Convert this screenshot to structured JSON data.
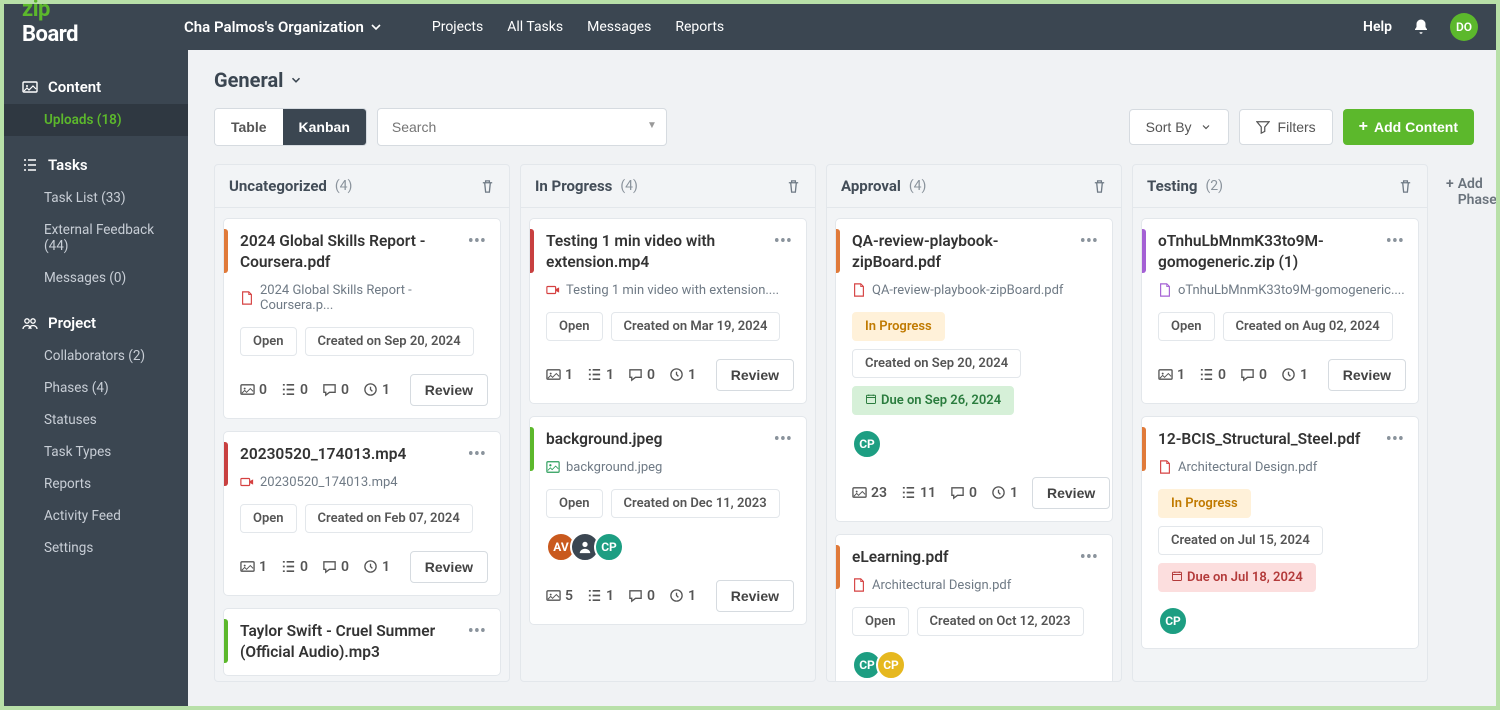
{
  "header": {
    "org_name": "Cha Palmos's Organization",
    "nav": [
      "Projects",
      "All Tasks",
      "Messages",
      "Reports"
    ],
    "help": "Help",
    "avatar": "DO"
  },
  "sidebar": {
    "sections": [
      {
        "title": "Content",
        "items": [
          {
            "label": "Uploads (18)",
            "active": true
          }
        ]
      },
      {
        "title": "Tasks",
        "items": [
          {
            "label": "Task List (33)"
          },
          {
            "label": "External Feedback (44)"
          },
          {
            "label": "Messages (0)"
          }
        ]
      },
      {
        "title": "Project",
        "items": [
          {
            "label": "Collaborators (2)"
          },
          {
            "label": "Phases (4)"
          },
          {
            "label": "Statuses"
          },
          {
            "label": "Task Types"
          },
          {
            "label": "Reports"
          },
          {
            "label": "Activity Feed"
          },
          {
            "label": "Settings"
          }
        ]
      }
    ]
  },
  "page": {
    "title": "General",
    "view": {
      "table": "Table",
      "kanban": "Kanban"
    },
    "search_placeholder": "Search",
    "sort_by": "Sort By",
    "filters": "Filters",
    "add_content": "Add Content",
    "add_phase": "Add Phase",
    "open": "Open",
    "review": "Review"
  },
  "columns": [
    {
      "title": "Uncategorized",
      "count": "(4)",
      "cards": [
        {
          "bar": "#e07a3a",
          "title": "2024 Global Skills Report - Coursera.pdf",
          "file_ico": "pdf",
          "file": "2024 Global Skills Report - Coursera.p...",
          "pills": [
            {
              "t": "Open",
              "k": "open"
            },
            {
              "t": "Created on Sep 20, 2024",
              "k": "plain"
            }
          ],
          "stats": {
            "img": "0",
            "list": "0",
            "chat": "0",
            "clock": "1"
          }
        },
        {
          "bar": "#c84040",
          "title": "20230520_174013.mp4",
          "file_ico": "video",
          "file": "20230520_174013.mp4",
          "pills": [
            {
              "t": "Open",
              "k": "open"
            },
            {
              "t": "Created on Feb 07, 2024",
              "k": "plain"
            }
          ],
          "stats": {
            "img": "1",
            "list": "0",
            "chat": "0",
            "clock": "1"
          }
        },
        {
          "bar": "#5cb82c",
          "title": "Taylor Swift - Cruel Summer (Official Audio).mp3",
          "file_ico": "audio",
          "file": "",
          "pills": [],
          "stats": null
        }
      ]
    },
    {
      "title": "In Progress",
      "count": "(4)",
      "cards": [
        {
          "bar": "#c84040",
          "title": "Testing 1 min video with extension.mp4",
          "file_ico": "video",
          "file": "Testing 1 min video with extension....",
          "pills": [
            {
              "t": "Open",
              "k": "open"
            },
            {
              "t": "Created on Mar 19, 2024",
              "k": "plain"
            }
          ],
          "stats": {
            "img": "1",
            "list": "1",
            "chat": "0",
            "clock": "1"
          }
        },
        {
          "bar": "#5cb82c",
          "title": "background.jpeg",
          "file_ico": "image",
          "file": "background.jpeg",
          "pills": [
            {
              "t": "Open",
              "k": "open"
            },
            {
              "t": "Created on Dec 11, 2023",
              "k": "plain"
            }
          ],
          "avatars": [
            {
              "t": "AV",
              "c": "#c9591e"
            },
            {
              "t": "",
              "c": "#3b4651",
              "icon": true
            },
            {
              "t": "CP",
              "c": "#1d9e82"
            }
          ],
          "stats": {
            "img": "5",
            "list": "1",
            "chat": "0",
            "clock": "1"
          }
        }
      ]
    },
    {
      "title": "Approval",
      "count": "(4)",
      "cards": [
        {
          "bar": "#e07a3a",
          "title": "QA-review-playbook-zipBoard.pdf",
          "file_ico": "pdf",
          "file": "QA-review-playbook-zipBoard.pdf",
          "pills": [
            {
              "t": "In Progress",
              "k": "warn"
            },
            {
              "t": "Created on Sep 20, 2024",
              "k": "plain"
            },
            {
              "t": "Due on Sep 26, 2024",
              "k": "due",
              "ico": true
            }
          ],
          "avatars": [
            {
              "t": "CP",
              "c": "#1d9e82"
            }
          ],
          "stats": {
            "img": "23",
            "list": "11",
            "chat": "0",
            "clock": "1"
          }
        },
        {
          "bar": "#e07a3a",
          "title": "eLearning.pdf",
          "file_ico": "pdf",
          "file": "Architectural Design.pdf",
          "pills": [
            {
              "t": "Open",
              "k": "open"
            },
            {
              "t": "Created on Oct 12, 2023",
              "k": "plain"
            }
          ],
          "avatars": [
            {
              "t": "CP",
              "c": "#1d9e82"
            },
            {
              "t": "CP",
              "c": "#e6b81f"
            }
          ],
          "stats": null
        }
      ]
    },
    {
      "title": "Testing",
      "count": "(2)",
      "cards": [
        {
          "bar": "#a460d4",
          "title": "oTnhuLbMnmK33to9M-gomogeneric.zip (1)",
          "file_ico": "zip",
          "file": "oTnhuLbMnmK33to9M-gomogeneric....",
          "pills": [
            {
              "t": "Open",
              "k": "open"
            },
            {
              "t": "Created on Aug 02, 2024",
              "k": "plain"
            }
          ],
          "stats": {
            "img": "1",
            "list": "0",
            "chat": "0",
            "clock": "1"
          }
        },
        {
          "bar": "#e07a3a",
          "title": "12-BCIS_Structural_Steel.pdf",
          "file_ico": "pdf",
          "file": "Architectural Design.pdf",
          "pills": [
            {
              "t": "In Progress",
              "k": "warn"
            },
            {
              "t": "Created on Jul 15, 2024",
              "k": "plain"
            },
            {
              "t": "Due on Jul 18, 2024",
              "k": "overdue",
              "ico": true
            }
          ],
          "avatars": [
            {
              "t": "CP",
              "c": "#1d9e82"
            }
          ],
          "stats": null
        }
      ]
    }
  ]
}
